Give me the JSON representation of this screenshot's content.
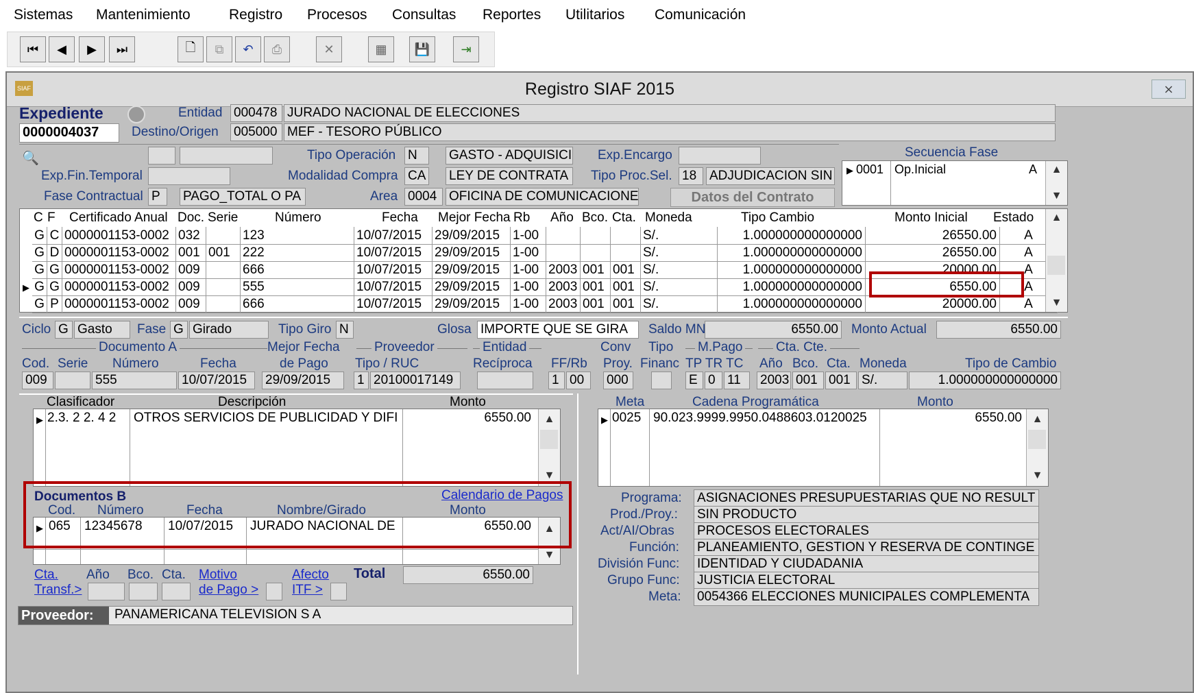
{
  "menu": [
    "Sistemas",
    "Mantenimiento",
    "Registro",
    "Procesos",
    "Consultas",
    "Reportes",
    "Utilitarios",
    "Comunicación"
  ],
  "window": {
    "title": "Registro SIAF 2015",
    "close": "⨯",
    "icon": "SIAF"
  },
  "exp": {
    "label": "Expediente",
    "number": "0000004037",
    "entidad_label": "Entidad",
    "entidad_code": "000478",
    "entidad_name": "JURADO NACIONAL DE ELECCIONES",
    "destino_label": "Destino/Origen",
    "destino_code": "005000",
    "destino_name": "MEF - TESORO PÚBLICO"
  },
  "op": {
    "tipo_op_label": "Tipo Operación",
    "tipo_op_code": "N",
    "tipo_op_name": "GASTO - ADQUISICI",
    "exp_encargo_label": "Exp.Encargo",
    "exp_fin_label": "Exp.Fin.Temporal",
    "modalidad_label": "Modalidad Compra",
    "modalidad_code": "CA",
    "modalidad_name": "LEY DE CONTRATA",
    "tipo_proc_label": "Tipo Proc.Sel.",
    "tipo_proc_code": "18",
    "tipo_proc_name": "ADJUDICACION SIN",
    "fase_label": "Fase Contractual",
    "fase_code": "P",
    "fase_name": "PAGO_TOTAL O PA",
    "area_label": "Area",
    "area_code": "0004",
    "area_name": "OFICINA DE COMUNICACIONE",
    "datos_contrato": "Datos del Contrato"
  },
  "secuencia": {
    "title": "Secuencia Fase",
    "code": "0001",
    "name": "Op.Inicial",
    "estado": "A"
  },
  "main_grid": {
    "headers": [
      "C",
      "F",
      "Certificado Anual",
      "Doc.",
      "Serie",
      "Número",
      "Fecha",
      "Mejor Fecha",
      "Rb",
      "Año",
      "Bco.",
      "Cta.",
      "Moneda",
      "Tipo Cambio",
      "Monto Inicial",
      "Estado"
    ],
    "rows": [
      [
        "G",
        "C",
        "0000001153-0002",
        "032",
        "",
        "123",
        "10/07/2015",
        "29/09/2015",
        "1-00",
        "",
        "",
        "",
        "S/.",
        "1.000000000000000",
        "26550.00",
        "A"
      ],
      [
        "G",
        "D",
        "0000001153-0002",
        "001",
        "001",
        "222",
        "10/07/2015",
        "29/09/2015",
        "1-00",
        "",
        "",
        "",
        "S/.",
        "1.000000000000000",
        "26550.00",
        "A"
      ],
      [
        "G",
        "G",
        "0000001153-0002",
        "009",
        "",
        "666",
        "10/07/2015",
        "29/09/2015",
        "1-00",
        "2003",
        "001",
        "001",
        "S/.",
        "1.000000000000000",
        "20000.00",
        "A"
      ],
      [
        "G",
        "G",
        "0000001153-0002",
        "009",
        "",
        "555",
        "10/07/2015",
        "29/09/2015",
        "1-00",
        "2003",
        "001",
        "001",
        "S/.",
        "1.000000000000000",
        "6550.00",
        "A"
      ],
      [
        "G",
        "P",
        "0000001153-0002",
        "009",
        "",
        "666",
        "10/07/2015",
        "29/09/2015",
        "1-00",
        "2003",
        "001",
        "001",
        "S/.",
        "1.000000000000000",
        "20000.00",
        "A"
      ]
    ]
  },
  "ciclo": {
    "ciclo_label": "Ciclo",
    "ciclo_code": "G",
    "ciclo_name": "Gasto",
    "fase_label": "Fase",
    "fase_code": "G",
    "fase_name": "Girado",
    "tipo_giro_label": "Tipo Giro",
    "tipo_giro_code": "N",
    "glosa_label": "Glosa",
    "glosa": "IMPORTE QUE SE GIRA",
    "saldo_label": "Saldo MN",
    "saldo": "6550.00",
    "monto_actual_label": "Monto Actual",
    "monto_actual": "6550.00"
  },
  "doca": {
    "group_doc": "Documento A",
    "cod": "Cod.",
    "serie": "Serie",
    "numero": "Número",
    "fecha": "Fecha",
    "mejor1": "Mejor Fecha",
    "mejor2": "de Pago",
    "group_prov": "Proveedor",
    "tipo_ruc": "Tipo / RUC",
    "group_ent": "Entidad",
    "reciproca": "Recíproca",
    "ffrb": "FF/Rb",
    "conv1": "Conv",
    "conv2": "Proy.",
    "tipo1": "Tipo",
    "tipo2": "Financ",
    "mpago": "M.Pago",
    "tptrtc": "TP TR TC",
    "ctacte": "Cta. Cte.",
    "anio": "Año",
    "bco": "Bco.",
    "cta": "Cta.",
    "moneda": "Moneda",
    "tipocambio": "Tipo de Cambio",
    "v_cod": "009",
    "v_num": "555",
    "v_fecha": "10/07/2015",
    "v_mejor": "29/09/2015",
    "v_tipo": "1",
    "v_ruc": "20100017149",
    "v_ff": "1",
    "v_rb": "00",
    "v_conv": "000",
    "v_tp": "E",
    "v_tr": "0",
    "v_tc": "11",
    "v_anio": "2003",
    "v_bco": "001",
    "v_cta": "001",
    "v_moneda": "S/.",
    "v_tcambio": "1.000000000000000"
  },
  "clasif": {
    "h_clas": "Clasificador",
    "h_desc": "Descripción",
    "h_monto": "Monto",
    "code": "2.3. 2 2. 4 2",
    "desc": "OTROS SERVICIOS DE PUBLICIDAD Y DIFI",
    "monto": "6550.00"
  },
  "meta": {
    "h_meta": "Meta",
    "h_cadena": "Cadena Programática",
    "h_monto": "Monto",
    "code": "0025",
    "cadena": "90.023.9999.9950.0488603.0120025",
    "monto": "6550.00"
  },
  "docb": {
    "title": "Documentos B",
    "calendario": "Calendario de Pagos",
    "h_cod": "Cod.",
    "h_num": "Número",
    "h_fecha": "Fecha",
    "h_nombre": "Nombre/Girado",
    "h_monto": "Monto",
    "cod": "065",
    "num": "12345678",
    "fecha": "10/07/2015",
    "nombre": "JURADO NACIONAL DE",
    "monto": "6550.00",
    "cta1": "Cta.",
    "cta2": "Transf.>",
    "anio": "Año",
    "bco": "Bco.",
    "cta": "Cta.",
    "motivo1": "Motivo",
    "motivo2": "de Pago >",
    "afecto1": "Afecto",
    "afecto2": "ITF >",
    "total_label": "Total",
    "total": "6550.00"
  },
  "prog": {
    "programa_label": "Programa:",
    "programa": "ASIGNACIONES PRESUPUESTARIAS QUE NO RESULT",
    "prod_label": "Prod./Proy.:",
    "prod": "SIN PRODUCTO",
    "act_label": "Act/AI/Obras",
    "act": "PROCESOS ELECTORALES",
    "funcion_label": "Función:",
    "funcion": "PLANEAMIENTO, GESTION Y RESERVA DE CONTINGE",
    "division_label": "División Func:",
    "division": "IDENTIDAD Y CIUDADANIA",
    "grupo_label": "Grupo Func:",
    "grupo": "JUSTICIA ELECTORAL",
    "meta_label": "Meta:",
    "meta": "0054366  ELECCIONES MUNICIPALES COMPLEMENTA"
  },
  "proveedor": {
    "label": "Proveedor:",
    "value": "PANAMERICANA TELEVISION S A"
  },
  "colors": {
    "accent": "#1c3a80",
    "highlight": "#b00000"
  }
}
